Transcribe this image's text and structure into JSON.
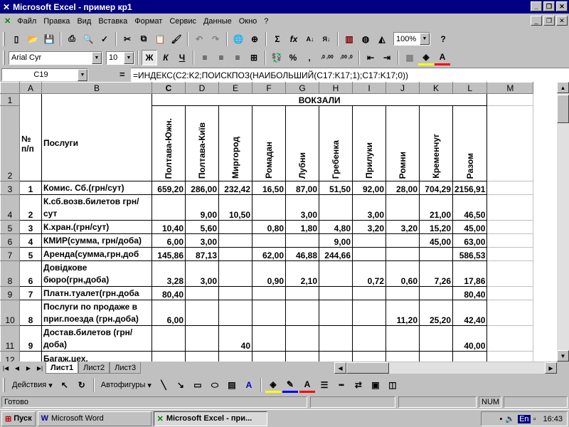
{
  "window": {
    "title": "Microsoft Excel - пример кр1"
  },
  "menu": [
    "Файл",
    "Правка",
    "Вид",
    "Вставка",
    "Формат",
    "Сервис",
    "Данные",
    "Окно",
    "?"
  ],
  "toolbar": {
    "zoom": "100%"
  },
  "format_bar": {
    "font": "Arial Cyr",
    "size": "10",
    "bold": "Ж",
    "italic": "К",
    "underline": "Ч",
    "percent": "%",
    "comma": ",",
    "inc_dec": ",0 ,00",
    "dec_dec": ",00 ,0"
  },
  "formula_bar": {
    "cell": "C19",
    "equals": "=",
    "formula": "=ИНДЕКС(C2:K2;ПОИСКПОЗ(НАИБОЛЬШИЙ(C17:K17;1);C17:K17;0))"
  },
  "columns": [
    "A",
    "B",
    "C",
    "D",
    "E",
    "F",
    "G",
    "H",
    "I",
    "J",
    "K",
    "L",
    "M"
  ],
  "header": {
    "vokzali": "ВОКЗАЛИ",
    "no": "№ п/п",
    "services": "Послуги"
  },
  "stations": [
    "Полтава-Южн.",
    "Полтава-Київ",
    "Миргород",
    "Ромадан",
    "Лубни",
    "Гребенка",
    "Прилуки",
    "Ромни",
    "Кременчуг",
    "Разом"
  ],
  "rows": [
    {
      "r": "3",
      "n": "1",
      "name": "Комис. Сб.(грн/сут)",
      "v": [
        "659,20",
        "286,00",
        "232,42",
        "16,50",
        "87,00",
        "51,50",
        "92,00",
        "28,00",
        "704,29",
        "2156,91"
      ]
    },
    {
      "r": "4",
      "n": "2",
      "name": "К.сб.возв.билетов грн/сут",
      "v": [
        "",
        "9,00",
        "10,50",
        "",
        "3,00",
        "",
        "3,00",
        "",
        "21,00",
        "46,50"
      ]
    },
    {
      "r": "5",
      "n": "3",
      "name": "К.хран.(грн/сут)",
      "v": [
        "10,40",
        "5,60",
        "",
        "0,80",
        "1,80",
        "4,80",
        "3,20",
        "3,20",
        "15,20",
        "45,00"
      ]
    },
    {
      "r": "6",
      "n": "4",
      "name": "КМИР(сумма, грн/доба)",
      "v": [
        "6,00",
        "3,00",
        "",
        "",
        "",
        "9,00",
        "",
        "",
        "45,00",
        "63,00"
      ]
    },
    {
      "r": "7",
      "n": "5",
      "name": "Аренда(сумма,грн,доб",
      "v": [
        "145,86",
        "87,13",
        "",
        "62,00",
        "46,88",
        "244,66",
        "",
        "",
        "",
        "586,53"
      ]
    },
    {
      "r": "8",
      "n": "6",
      "name": "Довідкове бюро(грн,доба)",
      "v": [
        "3,28",
        "3,00",
        "",
        "0,90",
        "2,10",
        "",
        "0,72",
        "0,60",
        "7,26",
        "17,86"
      ]
    },
    {
      "r": "9",
      "n": "7",
      "name": "Платн.туалет(грн.доба",
      "v": [
        "80,40",
        "",
        "",
        "",
        "",
        "",
        "",
        "",
        "",
        "80,40"
      ]
    },
    {
      "r": "10",
      "n": "8",
      "name": "Послуги по продаже в приг.поезда (грн.доба)",
      "v": [
        "6,00",
        "",
        "",
        "",
        "",
        "",
        "",
        "11,20",
        "25,20",
        "42,40"
      ]
    },
    {
      "r": "11",
      "n": "9",
      "name": "Достав.билетов (грн/доба)",
      "v": [
        "",
        "",
        "40",
        "",
        "",
        "",
        "",
        "",
        "",
        "40,00"
      ]
    },
    {
      "r": "12",
      "n": "",
      "name": "Багаж.цех,",
      "v": [
        "",
        "",
        "",
        "",
        "",
        "",
        "",
        "",
        "",
        ""
      ]
    }
  ],
  "row_labels": {
    "r1": "1",
    "r2": "2"
  },
  "sheets": [
    "Лист1",
    "Лист2",
    "Лист3"
  ],
  "drawing": {
    "actions": "Действия",
    "autoshapes": "Автофигуры"
  },
  "status": {
    "ready": "Готово",
    "num": "NUM"
  },
  "taskbar": {
    "start": "Пуск",
    "tasks": [
      "Microsoft Word",
      "Microsoft Excel - при..."
    ],
    "lang": "En",
    "time": "16:43"
  }
}
